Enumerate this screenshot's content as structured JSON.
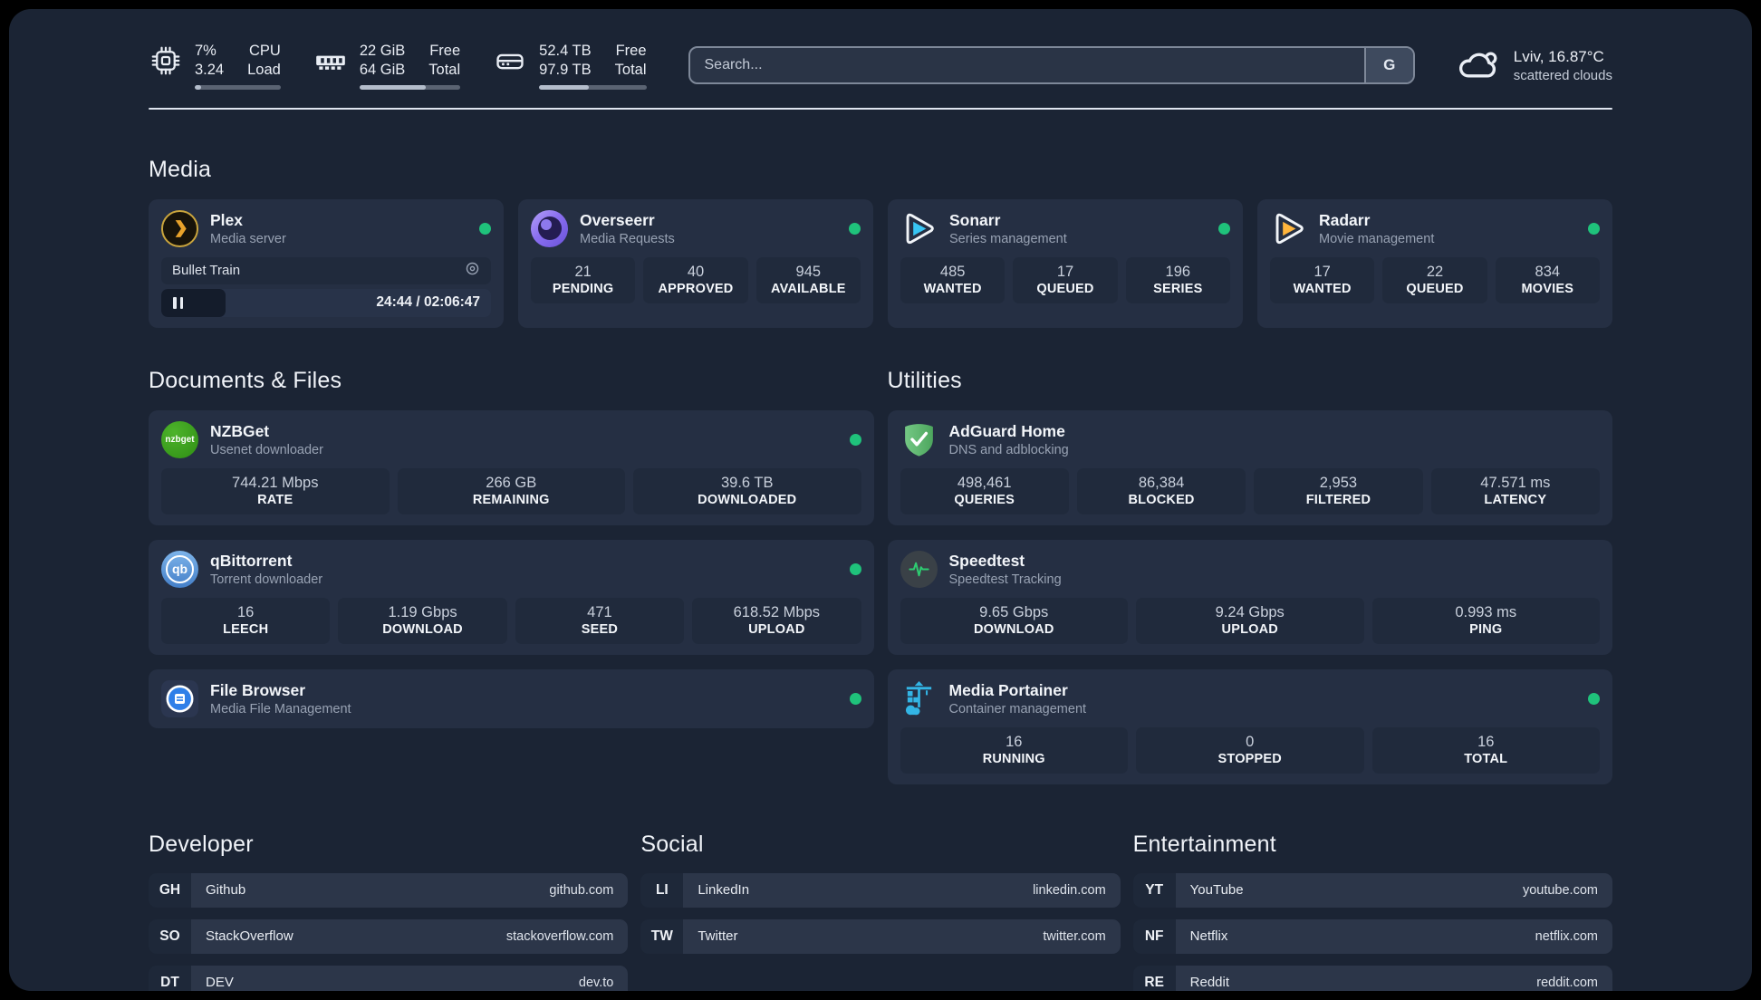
{
  "header": {
    "system_stats": [
      {
        "icon": "cpu-icon",
        "values": [
          "7%",
          "3.24"
        ],
        "labels": [
          "CPU",
          "Load"
        ],
        "progress_pct": 7
      },
      {
        "icon": "memory-icon",
        "values": [
          "22 GiB",
          "64 GiB"
        ],
        "labels": [
          "Free",
          "Total"
        ],
        "progress_pct": 66
      },
      {
        "icon": "disk-icon",
        "values": [
          "52.4 TB",
          "97.9 TB"
        ],
        "labels": [
          "Free",
          "Total"
        ],
        "progress_pct": 46
      }
    ],
    "search": {
      "placeholder": "Search...",
      "provider_button": "G"
    },
    "weather": {
      "icon": "cloud-icon",
      "location_temperature": "Lviv, 16.87°C",
      "condition": "scattered clouds"
    }
  },
  "sections": {
    "media": {
      "title": "Media",
      "cards": {
        "plex": {
          "icon": "plex-icon",
          "title": "Plex",
          "subtitle": "Media server",
          "status": "online",
          "now_playing": {
            "media_title": "Bullet Train",
            "state": "paused",
            "time": "24:44 / 02:06:47",
            "progress_pct": 19.5
          }
        },
        "overseerr": {
          "icon": "overseerr-icon",
          "title": "Overseerr",
          "subtitle": "Media Requests",
          "status": "online",
          "stats": [
            {
              "value": "21",
              "label": "PENDING"
            },
            {
              "value": "40",
              "label": "APPROVED"
            },
            {
              "value": "945",
              "label": "AVAILABLE"
            }
          ]
        },
        "sonarr": {
          "icon": "sonarr-icon",
          "title": "Sonarr",
          "subtitle": "Series management",
          "status": "online",
          "stats": [
            {
              "value": "485",
              "label": "WANTED"
            },
            {
              "value": "17",
              "label": "QUEUED"
            },
            {
              "value": "196",
              "label": "SERIES"
            }
          ]
        },
        "radarr": {
          "icon": "radarr-icon",
          "title": "Radarr",
          "subtitle": "Movie management",
          "status": "online",
          "stats": [
            {
              "value": "17",
              "label": "WANTED"
            },
            {
              "value": "22",
              "label": "QUEUED"
            },
            {
              "value": "834",
              "label": "MOVIES"
            }
          ]
        }
      }
    },
    "documents": {
      "title": "Documents & Files",
      "cards": {
        "nzbget": {
          "icon": "nzbget-icon",
          "title": "NZBGet",
          "subtitle": "Usenet downloader",
          "status": "online",
          "stats": [
            {
              "value": "744.21 Mbps",
              "label": "RATE"
            },
            {
              "value": "266 GB",
              "label": "REMAINING"
            },
            {
              "value": "39.6 TB",
              "label": "DOWNLOADED"
            }
          ]
        },
        "qbittorrent": {
          "icon": "qbittorrent-icon",
          "title": "qBittorrent",
          "subtitle": "Torrent downloader",
          "status": "online",
          "stats": [
            {
              "value": "16",
              "label": "LEECH"
            },
            {
              "value": "1.19 Gbps",
              "label": "DOWNLOAD"
            },
            {
              "value": "471",
              "label": "SEED"
            },
            {
              "value": "618.52 Mbps",
              "label": "UPLOAD"
            }
          ]
        },
        "filebrowser": {
          "icon": "filebrowser-icon",
          "title": "File Browser",
          "subtitle": "Media File Management",
          "status": "online"
        }
      }
    },
    "utilities": {
      "title": "Utilities",
      "cards": {
        "adguard": {
          "icon": "adguard-icon",
          "title": "AdGuard Home",
          "subtitle": "DNS and adblocking",
          "stats": [
            {
              "value": "498,461",
              "label": "QUERIES"
            },
            {
              "value": "86,384",
              "label": "BLOCKED"
            },
            {
              "value": "2,953",
              "label": "FILTERED"
            },
            {
              "value": "47.571 ms",
              "label": "LATENCY"
            }
          ]
        },
        "speedtest": {
          "icon": "speedtest-icon",
          "title": "Speedtest",
          "subtitle": "Speedtest Tracking",
          "stats": [
            {
              "value": "9.65 Gbps",
              "label": "DOWNLOAD"
            },
            {
              "value": "9.24 Gbps",
              "label": "UPLOAD"
            },
            {
              "value": "0.993 ms",
              "label": "PING"
            }
          ]
        },
        "portainer": {
          "icon": "portainer-icon",
          "title": "Media Portainer",
          "subtitle": "Container management",
          "status": "online",
          "stats": [
            {
              "value": "16",
              "label": "RUNNING"
            },
            {
              "value": "0",
              "label": "STOPPED"
            },
            {
              "value": "16",
              "label": "TOTAL"
            }
          ]
        }
      }
    },
    "bookmarks": [
      {
        "title": "Developer",
        "links": [
          {
            "abbr": "GH",
            "name": "Github",
            "url": "github.com"
          },
          {
            "abbr": "SO",
            "name": "StackOverflow",
            "url": "stackoverflow.com"
          },
          {
            "abbr": "DT",
            "name": "DEV",
            "url": "dev.to"
          }
        ]
      },
      {
        "title": "Social",
        "links": [
          {
            "abbr": "LI",
            "name": "LinkedIn",
            "url": "linkedin.com"
          },
          {
            "abbr": "TW",
            "name": "Twitter",
            "url": "twitter.com"
          }
        ]
      },
      {
        "title": "Entertainment",
        "links": [
          {
            "abbr": "YT",
            "name": "YouTube",
            "url": "youtube.com"
          },
          {
            "abbr": "NF",
            "name": "Netflix",
            "url": "netflix.com"
          },
          {
            "abbr": "RE",
            "name": "Reddit",
            "url": "reddit.com"
          }
        ]
      }
    ]
  },
  "colors": {
    "background": "#1b2434",
    "card": "#252f43",
    "stat_box": "#202a3c",
    "status_online": "#1fc27b",
    "plex_amber": "#e5a00d",
    "sonarr_blue": "#38c6f4",
    "radarr_amber": "#ffb53c",
    "nzbget_green": "#3aa71c",
    "qbittorrent_blue": "#4b8ad6",
    "filebrowser_blue": "#2f7fe8",
    "adguard_green": "#5fb870",
    "speedtest_green": "#2ecc71",
    "portainer_blue": "#33b5e5"
  }
}
